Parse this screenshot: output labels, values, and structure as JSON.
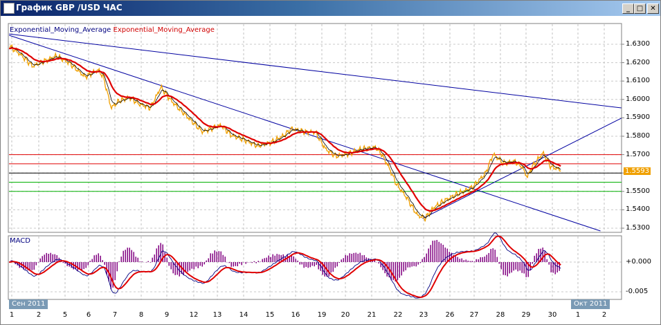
{
  "window": {
    "title": "График GBP /USD  ЧАС",
    "buttons": {
      "minimize": "_",
      "maximize": "□",
      "close": "✕"
    }
  },
  "legend": {
    "ema1": "Exponential_Moving_Average",
    "ema2": "Exponential_Moving_Average"
  },
  "macd": {
    "label": "MACD",
    "ticks": [
      "+0.000",
      "-0.005"
    ]
  },
  "price_axis": {
    "ticks": [
      "1.6300",
      "1.6200",
      "1.6100",
      "1.6000",
      "1.5900",
      "1.5800",
      "1.5700",
      "1.5600",
      "1.5500",
      "1.5400",
      "1.5300"
    ],
    "last_price": "1.5593"
  },
  "date_axis": {
    "month1": "Сен 2011",
    "month2": "Окт 2011",
    "days": [
      "1",
      "2",
      "5",
      "6",
      "7",
      "8",
      "9",
      "12",
      "13",
      "14",
      "15",
      "16",
      "19",
      "20",
      "21",
      "22",
      "23",
      "26",
      "27",
      "28",
      "29",
      "30",
      "1",
      "2"
    ]
  },
  "colors": {
    "price": "#f0a000",
    "ema_fast": "#000080",
    "ema_slow": "#e00000",
    "trend": "#0000a0",
    "macd_hist": "#800080",
    "level_red": "#e00000",
    "level_green": "#00b000"
  },
  "chart_data": {
    "type": "line",
    "title": "GBP/USD H1",
    "x_unit": "trading day index (0 = 1 Sep 2011)",
    "price": {
      "t": [
        -0.1,
        0.4,
        0.8,
        1.2,
        1.7,
        2.2,
        2.8,
        3.3,
        3.5,
        3.8,
        4.1,
        4.5,
        4.9,
        5.3,
        5.7,
        6.1,
        6.5,
        6.9,
        7.3,
        7.6,
        8.0,
        8.4,
        8.8,
        9.4,
        9.9,
        10.4,
        10.7,
        11.2,
        11.6,
        12.0,
        12.4,
        12.8,
        13.3,
        13.9,
        14.1,
        14.4,
        14.7,
        15.1,
        15.5,
        15.8,
        16.1,
        16.5,
        17.0,
        17.6,
        18.1,
        18.4,
        18.8,
        19.2,
        19.5,
        19.7,
        19.9,
        20.3,
        20.6,
        21.0
      ],
      "close": [
        1.6292,
        1.6236,
        1.618,
        1.6206,
        1.6236,
        1.6198,
        1.6123,
        1.6161,
        1.6123,
        1.5954,
        1.5992,
        1.6011,
        1.5973,
        1.5954,
        1.6067,
        1.5992,
        1.5935,
        1.5879,
        1.5823,
        1.5841,
        1.586,
        1.5804,
        1.5785,
        1.5747,
        1.5766,
        1.5804,
        1.5841,
        1.5823,
        1.5823,
        1.5729,
        1.5691,
        1.5702,
        1.5729,
        1.574,
        1.571,
        1.5635,
        1.5541,
        1.5465,
        1.5371,
        1.5353,
        1.5409,
        1.5447,
        1.5484,
        1.5522,
        1.5597,
        1.5702,
        1.5653,
        1.5665,
        1.5635,
        1.5578,
        1.5635,
        1.571,
        1.5635,
        1.5616
      ]
    },
    "trendlines": [
      {
        "t": [
          -0.1,
          23.3
        ],
        "price": [
          1.6356,
          1.5954
        ]
      },
      {
        "t": [
          -0.1,
          22.5
        ],
        "price": [
          1.6349,
          1.5285
        ]
      },
      {
        "t": [
          15.7,
          23.3
        ],
        "price": [
          1.5353,
          1.5898
        ]
      }
    ],
    "levels": [
      {
        "price": 1.57,
        "color": "red"
      },
      {
        "price": 1.565,
        "color": "red"
      },
      {
        "price": 1.56,
        "color": "black"
      },
      {
        "price": 1.555,
        "color": "green"
      },
      {
        "price": 1.55,
        "color": "green"
      }
    ],
    "ylim": [
      1.528,
      1.637
    ],
    "macd_ylim": [
      -0.007,
      0.003
    ]
  }
}
